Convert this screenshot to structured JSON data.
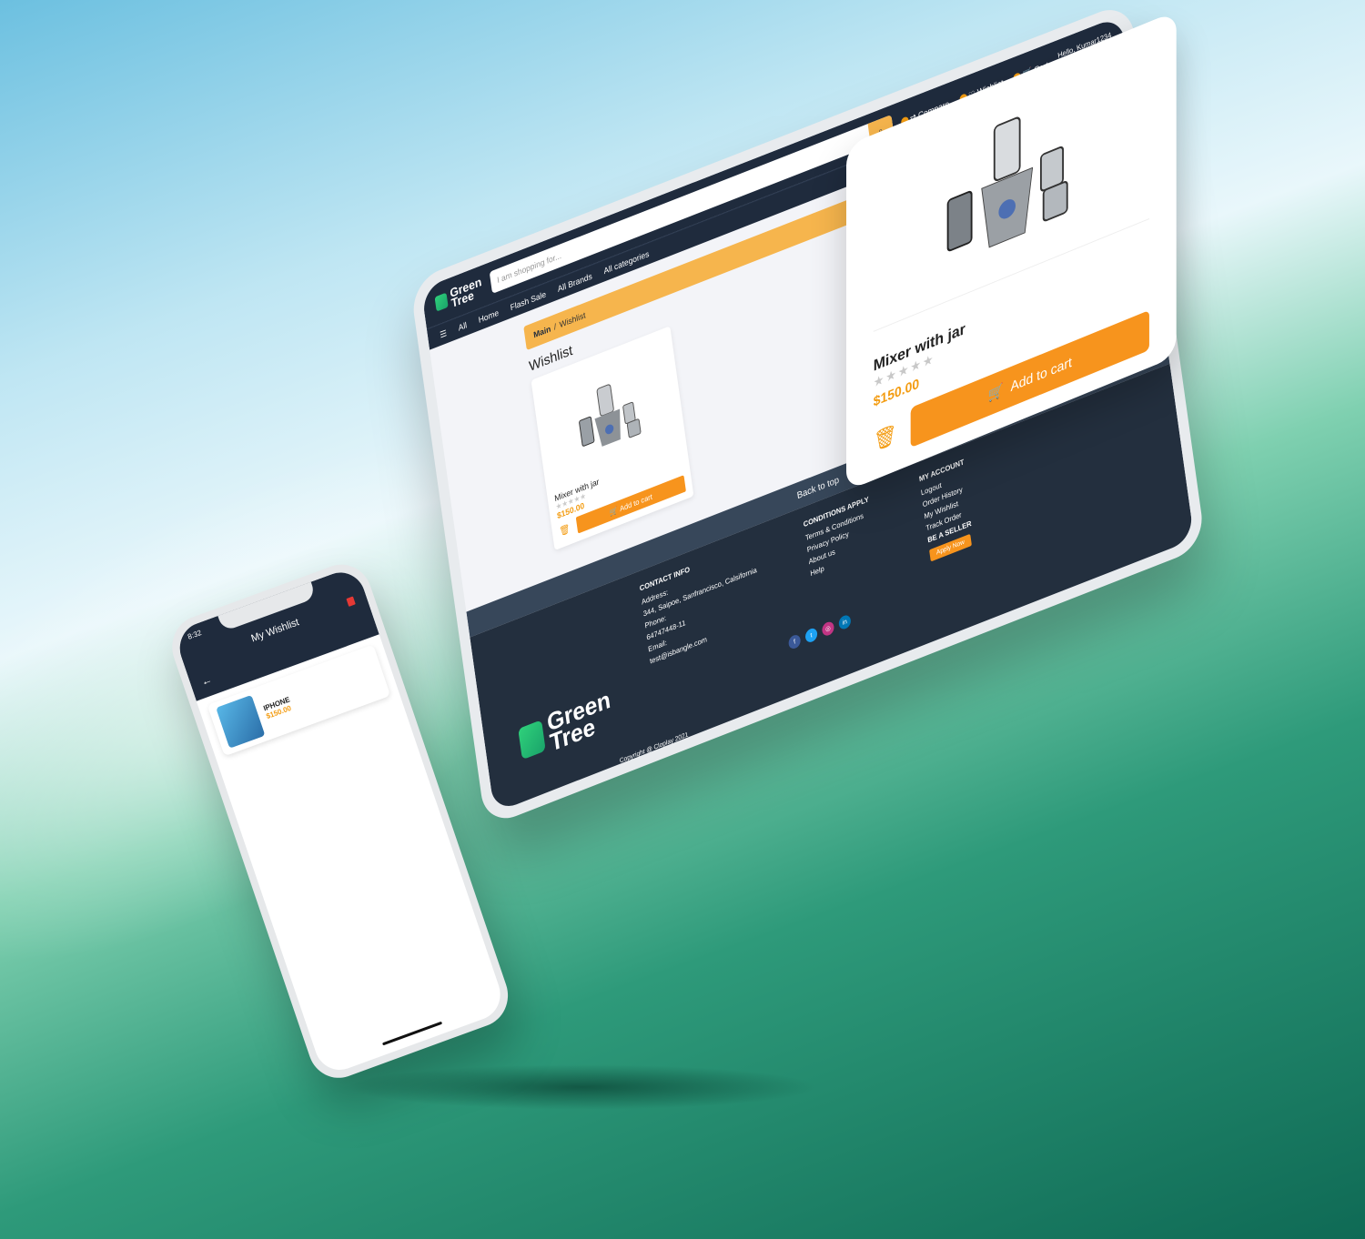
{
  "tablet": {
    "logo": {
      "line1": "Green",
      "line2": "Tree"
    },
    "search_placeholder": "I am shopping for...",
    "actions": {
      "compare": "Compare",
      "wishlist": "Wishlist",
      "cart": "Cart"
    },
    "user": {
      "greeting": "Hello, Kumar1234",
      "account": "Account & Lists"
    },
    "nav": [
      "All",
      "Home",
      "Flash Sale",
      "All Brands",
      "All categories"
    ],
    "breadcrumb": {
      "main": "Main",
      "sep": "/",
      "current": "Wishlist"
    },
    "heading": "Wishlist",
    "card": {
      "name": "Mixer with jar",
      "stars": "★★★★★",
      "price": "$150.00",
      "add_label": "Add to cart"
    },
    "back_to_top": "Back to top",
    "footer": {
      "contact": {
        "title": "CONTACT INFO",
        "address_label": "Address:",
        "address": "344, Saipoe, Sanfrancisco, Calsifornia",
        "phone_label": "Phone:",
        "phone": "64747448-11",
        "email_label": "Email:",
        "email": "test@isbangle.com"
      },
      "conditions": {
        "title": "CONDITIONS APPLY",
        "items": [
          "Terms & Conditions",
          "Privacy Policy",
          "About us",
          "Help"
        ]
      },
      "account": {
        "title": "MY ACCOUNT",
        "items": [
          "Logout",
          "Order History",
          "My Wishlist",
          "Track Order"
        ]
      },
      "seller": {
        "title": "BE A SELLER",
        "button": "Apply Now"
      },
      "social": [
        "f",
        "t",
        "◎",
        "in"
      ],
      "copyright": "Copyright @ Cloplay 2021"
    }
  },
  "float_card": {
    "name": "Mixer with jar",
    "stars": "★★★★★",
    "price": "$150.00",
    "add_label": "Add to cart"
  },
  "phone": {
    "time": "8:32",
    "title": "My Wishlist",
    "item": {
      "name": "IPHONE",
      "price": "$150.00"
    }
  },
  "colors": {
    "navy": "#1f2b3d",
    "orange": "#f7941d",
    "accent": "#f6b54d",
    "green": "#2fd17b"
  }
}
